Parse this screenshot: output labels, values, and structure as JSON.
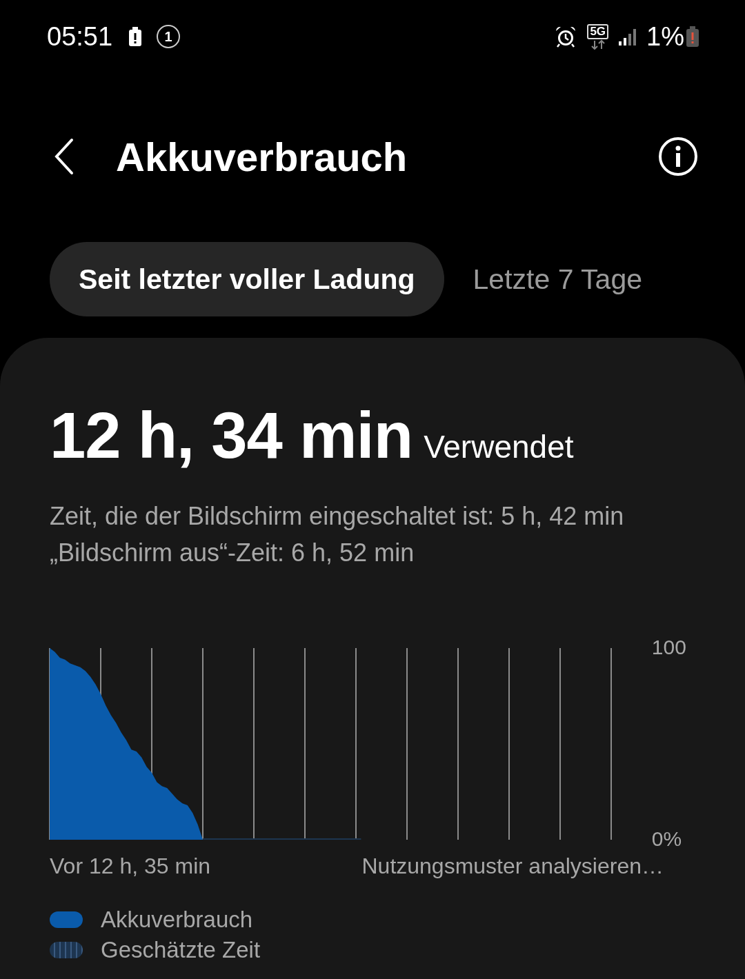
{
  "status_bar": {
    "time": "05:51",
    "notification_count": "1",
    "network": "5G",
    "battery": "1%"
  },
  "header": {
    "title": "Akkuverbrauch"
  },
  "tabs": [
    {
      "label": "Seit letzter voller Ladung",
      "selected": true
    },
    {
      "label": "Letzte 7 Tage",
      "selected": false
    }
  ],
  "summary": {
    "duration": "12 h, 34 min",
    "duration_label": "Verwendet",
    "lines": [
      "Zeit, die der Bildschirm eingeschaltet ist: 5 h, 42 min",
      "„Bildschirm aus“-Zeit: 6 h, 52 min"
    ]
  },
  "chart": {
    "top_label": "100",
    "bottom_label": "0%",
    "start_label": "Vor 12 h, 35 min",
    "end_label": "Nutzungsmuster analysieren…"
  },
  "legend": [
    {
      "kind": "solid",
      "label": "Akkuverbrauch"
    },
    {
      "kind": "striped",
      "label": "Geschätzte Zeit"
    }
  ]
}
